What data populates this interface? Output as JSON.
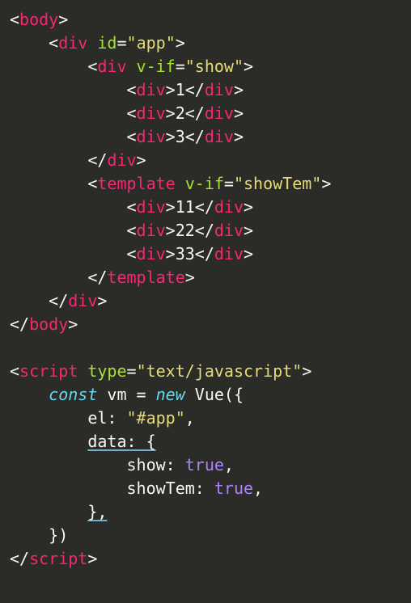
{
  "code": {
    "lines": [
      {
        "indent": 0,
        "tokens": [
          {
            "cls": "w",
            "t": "<"
          },
          {
            "cls": "p",
            "t": "body"
          },
          {
            "cls": "w",
            "t": ">"
          }
        ]
      },
      {
        "indent": 1,
        "tokens": [
          {
            "cls": "w",
            "t": "<"
          },
          {
            "cls": "p",
            "t": "div"
          },
          {
            "cls": "w",
            "t": " "
          },
          {
            "cls": "g",
            "t": "id"
          },
          {
            "cls": "w",
            "t": "="
          },
          {
            "cls": "y",
            "t": "\"app\""
          },
          {
            "cls": "w",
            "t": ">"
          }
        ]
      },
      {
        "indent": 2,
        "tokens": [
          {
            "cls": "w",
            "t": "<"
          },
          {
            "cls": "p",
            "t": "div"
          },
          {
            "cls": "w",
            "t": " "
          },
          {
            "cls": "g",
            "t": "v-if"
          },
          {
            "cls": "w",
            "t": "="
          },
          {
            "cls": "y",
            "t": "\"show\""
          },
          {
            "cls": "w",
            "t": ">"
          }
        ]
      },
      {
        "indent": 3,
        "tokens": [
          {
            "cls": "w",
            "t": "<"
          },
          {
            "cls": "p",
            "t": "div"
          },
          {
            "cls": "w",
            "t": ">1</"
          },
          {
            "cls": "p",
            "t": "div"
          },
          {
            "cls": "w",
            "t": ">"
          }
        ]
      },
      {
        "indent": 3,
        "tokens": [
          {
            "cls": "w",
            "t": "<"
          },
          {
            "cls": "p",
            "t": "div"
          },
          {
            "cls": "w",
            "t": ">2</"
          },
          {
            "cls": "p",
            "t": "div"
          },
          {
            "cls": "w",
            "t": ">"
          }
        ]
      },
      {
        "indent": 3,
        "tokens": [
          {
            "cls": "w",
            "t": "<"
          },
          {
            "cls": "p",
            "t": "div"
          },
          {
            "cls": "w",
            "t": ">3</"
          },
          {
            "cls": "p",
            "t": "div"
          },
          {
            "cls": "w",
            "t": ">"
          }
        ]
      },
      {
        "indent": 2,
        "tokens": [
          {
            "cls": "w",
            "t": "</"
          },
          {
            "cls": "p",
            "t": "div"
          },
          {
            "cls": "w",
            "t": ">"
          }
        ]
      },
      {
        "indent": 2,
        "tokens": [
          {
            "cls": "w",
            "t": "<"
          },
          {
            "cls": "p",
            "t": "template"
          },
          {
            "cls": "w",
            "t": " "
          },
          {
            "cls": "g",
            "t": "v-if"
          },
          {
            "cls": "w",
            "t": "="
          },
          {
            "cls": "y",
            "t": "\"showTem\""
          },
          {
            "cls": "w",
            "t": ">"
          }
        ]
      },
      {
        "indent": 3,
        "tokens": [
          {
            "cls": "w",
            "t": "<"
          },
          {
            "cls": "p",
            "t": "div"
          },
          {
            "cls": "w",
            "t": ">11</"
          },
          {
            "cls": "p",
            "t": "div"
          },
          {
            "cls": "w",
            "t": ">"
          }
        ]
      },
      {
        "indent": 3,
        "tokens": [
          {
            "cls": "w",
            "t": "<"
          },
          {
            "cls": "p",
            "t": "div"
          },
          {
            "cls": "w",
            "t": ">22</"
          },
          {
            "cls": "p",
            "t": "div"
          },
          {
            "cls": "w",
            "t": ">"
          }
        ]
      },
      {
        "indent": 3,
        "tokens": [
          {
            "cls": "w",
            "t": "<"
          },
          {
            "cls": "p",
            "t": "div"
          },
          {
            "cls": "w",
            "t": ">33</"
          },
          {
            "cls": "p",
            "t": "div"
          },
          {
            "cls": "w",
            "t": ">"
          }
        ]
      },
      {
        "indent": 2,
        "tokens": [
          {
            "cls": "w",
            "t": "</"
          },
          {
            "cls": "p",
            "t": "template"
          },
          {
            "cls": "w",
            "t": ">"
          }
        ]
      },
      {
        "indent": 1,
        "tokens": [
          {
            "cls": "w",
            "t": "</"
          },
          {
            "cls": "p",
            "t": "div"
          },
          {
            "cls": "w",
            "t": ">"
          }
        ]
      },
      {
        "indent": 0,
        "tokens": [
          {
            "cls": "w",
            "t": "</"
          },
          {
            "cls": "p",
            "t": "body"
          },
          {
            "cls": "w",
            "t": ">"
          }
        ]
      },
      {
        "indent": 0,
        "blank": true,
        "tokens": []
      },
      {
        "indent": 0,
        "tokens": [
          {
            "cls": "w",
            "t": "<"
          },
          {
            "cls": "p",
            "t": "script"
          },
          {
            "cls": "w",
            "t": " "
          },
          {
            "cls": "g",
            "t": "type"
          },
          {
            "cls": "w",
            "t": "="
          },
          {
            "cls": "y",
            "t": "\"text/javascript\""
          },
          {
            "cls": "w",
            "t": ">"
          }
        ]
      },
      {
        "indent": 1,
        "tokens": [
          {
            "cls": "b",
            "t": "const"
          },
          {
            "cls": "w",
            "t": " vm = "
          },
          {
            "cls": "b",
            "t": "new"
          },
          {
            "cls": "w",
            "t": " Vue({"
          }
        ]
      },
      {
        "indent": 2,
        "tokens": [
          {
            "cls": "w",
            "t": "el: "
          },
          {
            "cls": "y",
            "t": "\"#app\""
          },
          {
            "cls": "w",
            "t": ","
          }
        ]
      },
      {
        "indent": 2,
        "ul": true,
        "tokens": [
          {
            "cls": "w",
            "t": "data: {"
          }
        ]
      },
      {
        "indent": 3,
        "tokens": [
          {
            "cls": "w",
            "t": "show: "
          },
          {
            "cls": "pu",
            "t": "true"
          },
          {
            "cls": "w",
            "t": ","
          }
        ]
      },
      {
        "indent": 3,
        "tokens": [
          {
            "cls": "w",
            "t": "showTem: "
          },
          {
            "cls": "pu",
            "t": "true"
          },
          {
            "cls": "w",
            "t": ","
          }
        ]
      },
      {
        "indent": 2,
        "ul": true,
        "tokens": [
          {
            "cls": "w",
            "t": "},"
          }
        ]
      },
      {
        "indent": 1,
        "tokens": [
          {
            "cls": "w",
            "t": "})"
          }
        ]
      },
      {
        "indent": 0,
        "tokens": [
          {
            "cls": "w",
            "t": "</"
          },
          {
            "cls": "p",
            "t": "script"
          },
          {
            "cls": "w",
            "t": ">"
          }
        ]
      }
    ],
    "indentUnit": "    "
  }
}
